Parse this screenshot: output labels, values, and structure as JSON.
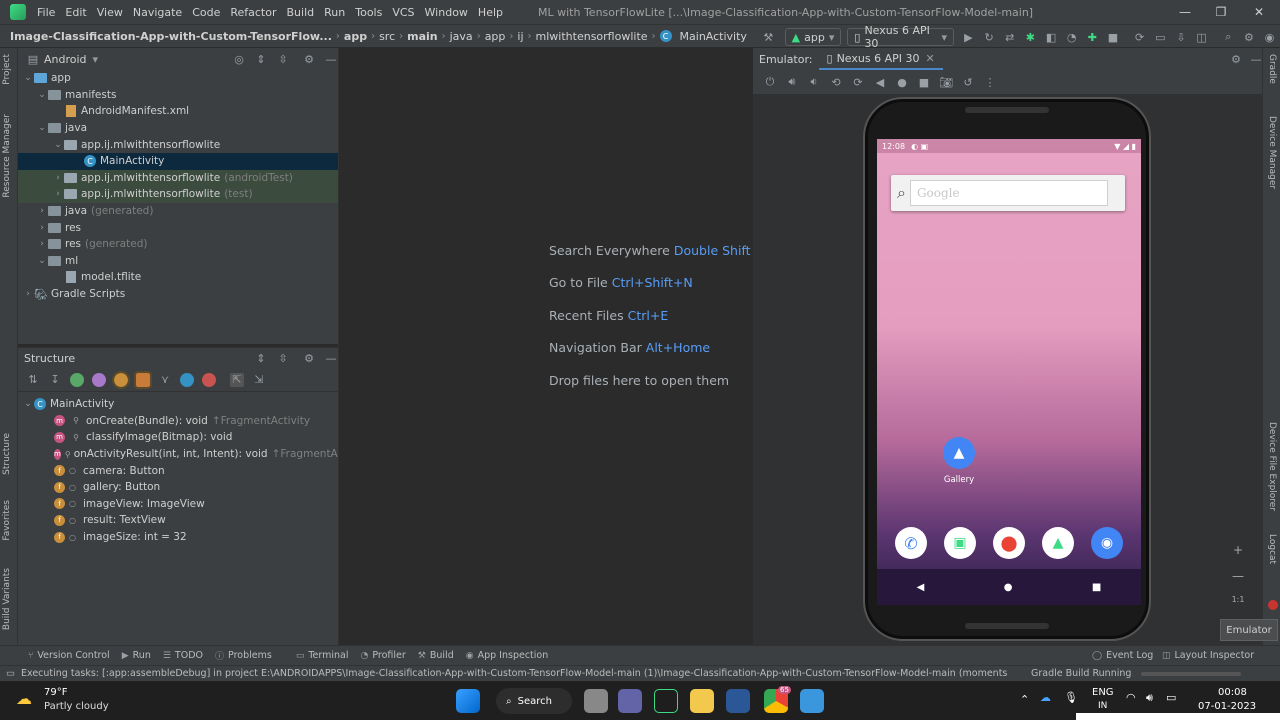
{
  "menubar": {
    "items": [
      "File",
      "Edit",
      "View",
      "Navigate",
      "Code",
      "Refactor",
      "Build",
      "Run",
      "Tools",
      "VCS",
      "Window",
      "Help"
    ],
    "window_title": "ML with TensorFlowLite [...\\Image-Classification-App-with-Custom-TensorFlow-Model-main]"
  },
  "navbar": {
    "breadcrumbs": [
      "Image-Classification-App-with-Custom-TensorFlow...",
      "app",
      "src",
      "main",
      "java",
      "app",
      "ij",
      "mlwithtensorflowlite",
      "MainActivity"
    ],
    "run_config": "app",
    "device": "Nexus 6 API 30"
  },
  "project_panel": {
    "view_mode": "Android",
    "tree": [
      {
        "label": "app",
        "indent": 0,
        "expanded": true,
        "kind": "module"
      },
      {
        "label": "manifests",
        "indent": 1,
        "expanded": true,
        "kind": "folder"
      },
      {
        "label": "AndroidManifest.xml",
        "indent": 3,
        "kind": "file"
      },
      {
        "label": "java",
        "indent": 1,
        "expanded": true,
        "kind": "folder"
      },
      {
        "label": "app.ij.mlwithtensorflowlite",
        "indent": 2,
        "expanded": true,
        "kind": "package"
      },
      {
        "label": "MainActivity",
        "indent": 4,
        "kind": "class",
        "selected": true
      },
      {
        "label": "app.ij.mlwithtensorflowlite",
        "suffix": "(androidTest)",
        "indent": 2,
        "collapsed": true,
        "kind": "package",
        "green": true
      },
      {
        "label": "app.ij.mlwithtensorflowlite",
        "suffix": "(test)",
        "indent": 2,
        "collapsed": true,
        "kind": "package",
        "green": true
      },
      {
        "label": "java",
        "suffix": "(generated)",
        "indent": 1,
        "collapsed": true,
        "kind": "folder"
      },
      {
        "label": "res",
        "indent": 1,
        "collapsed": true,
        "kind": "folder"
      },
      {
        "label": "res",
        "suffix": "(generated)",
        "indent": 1,
        "collapsed": true,
        "kind": "folder"
      },
      {
        "label": "ml",
        "indent": 1,
        "expanded": true,
        "kind": "folder"
      },
      {
        "label": "model.tflite",
        "indent": 3,
        "kind": "file"
      },
      {
        "label": "Gradle Scripts",
        "indent": 0,
        "collapsed": true,
        "kind": "gradle"
      }
    ]
  },
  "structure_panel": {
    "title": "Structure",
    "class_name": "MainActivity",
    "members": [
      {
        "kind": "m",
        "label": "onCreate(Bundle): void",
        "inherited": "↑FragmentActivity"
      },
      {
        "kind": "m",
        "label": "classifyImage(Bitmap): void",
        "inherited": ""
      },
      {
        "kind": "m",
        "label": "onActivityResult(int, int, Intent): void",
        "inherited": "↑FragmentActivity"
      },
      {
        "kind": "f",
        "label": "camera: Button",
        "inherited": ""
      },
      {
        "kind": "f",
        "label": "gallery: Button",
        "inherited": ""
      },
      {
        "kind": "f",
        "label": "imageView: ImageView",
        "inherited": ""
      },
      {
        "kind": "f",
        "label": "result: TextView",
        "inherited": ""
      },
      {
        "kind": "f",
        "label": "imageSize: int = 32",
        "inherited": ""
      }
    ]
  },
  "editor_hints": [
    {
      "label": "Search Everywhere",
      "key": "Double Shift"
    },
    {
      "label": "Go to File",
      "key": "Ctrl+Shift+N"
    },
    {
      "label": "Recent Files",
      "key": "Ctrl+E"
    },
    {
      "label": "Navigation Bar",
      "key": "Alt+Home"
    },
    {
      "label": "Drop files here to open them",
      "key": ""
    }
  ],
  "emulator": {
    "label": "Emulator:",
    "tab": "Nexus 6 API 30",
    "zoom_label": "1:1",
    "tooltip": "Emulator",
    "phone": {
      "time": "12:08",
      "search_placeholder": "Google",
      "gallery_label": "Gallery"
    }
  },
  "left_strip": [
    "Project",
    "Resource Manager",
    "Structure",
    "Favorites",
    "Build Variants"
  ],
  "right_strip": [
    "Gradle",
    "Device Manager",
    "Device File Explorer",
    "Logcat"
  ],
  "toolwindows": [
    "Version Control",
    "Run",
    "TODO",
    "Problems",
    "Terminal",
    "Profiler",
    "Build",
    "App Inspection"
  ],
  "toolwindows_right": [
    "Event Log",
    "Layout Inspector"
  ],
  "statusline": {
    "message": "Executing tasks: [:app:assembleDebug] in project E:\\ANDROIDAPPS\\Image-Classification-App-with-Custom-TensorFlow-Model-main (1)\\Image-Classification-App-with-Custom-TensorFlow-Model-main (moments ago)",
    "progress": "Gradle Build Running"
  },
  "taskbar": {
    "weather_temp": "79°F",
    "weather_desc": "Partly cloudy",
    "search_label": "Search",
    "lang": "ENG",
    "lang_sub": "IN",
    "time": "00:08",
    "date": "07-01-2023",
    "chrome_badge": "65"
  }
}
